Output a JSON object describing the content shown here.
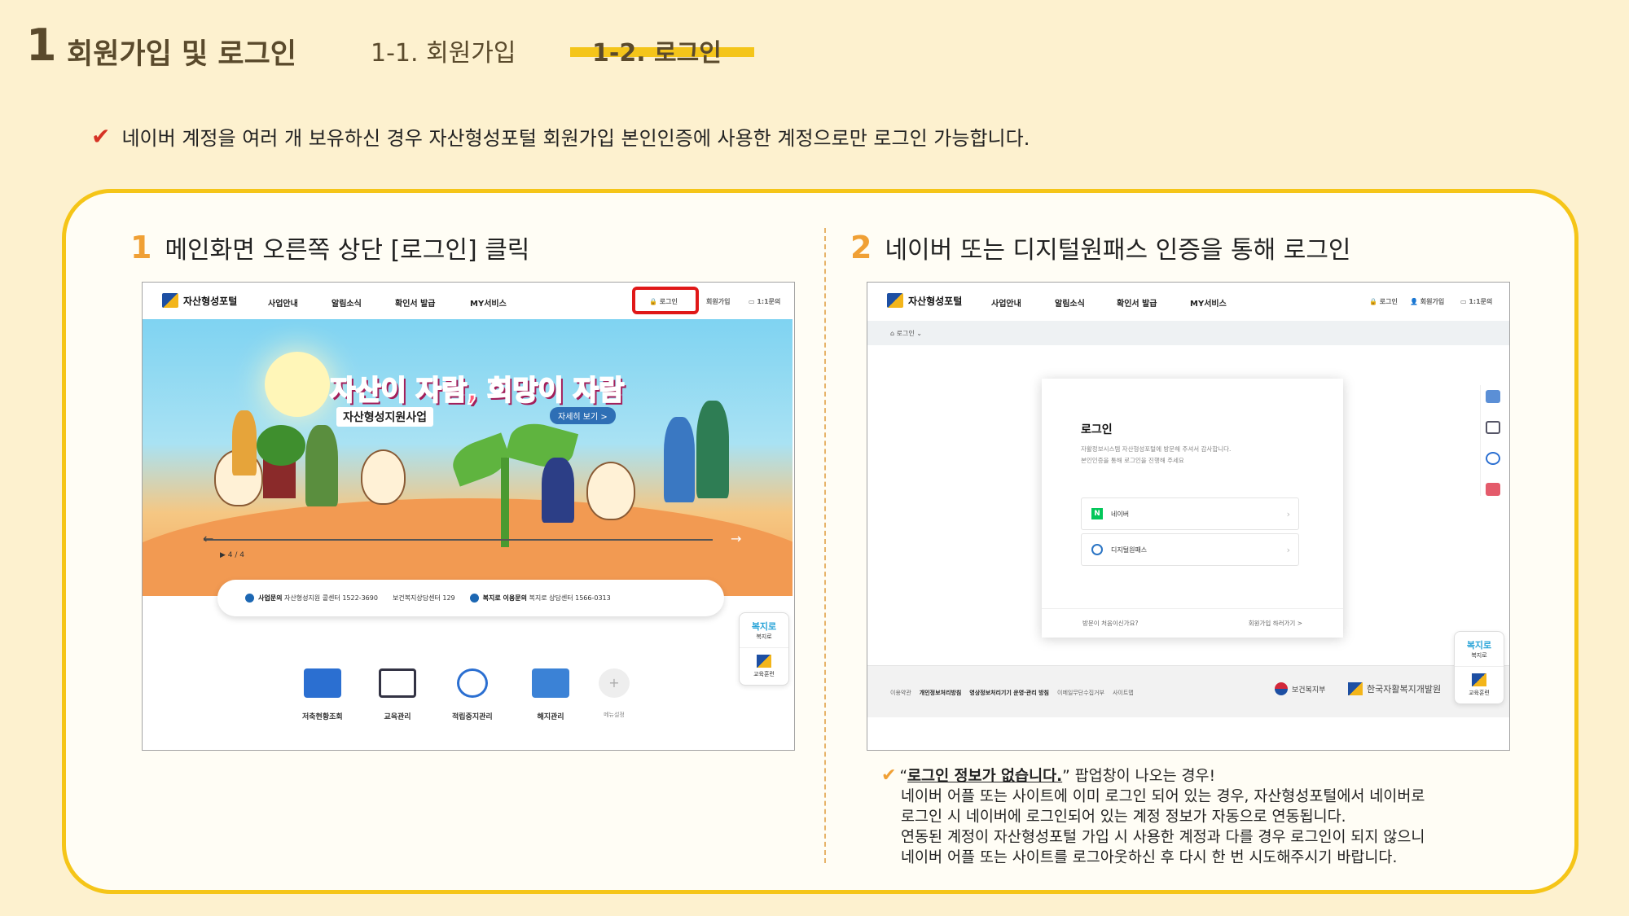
{
  "header": {
    "section_number": "1",
    "section_title": "회원가입 및 로그인",
    "sub_1": "1-1. 회원가입",
    "sub_2": "1-2. 로그인"
  },
  "notice": {
    "check": "✔",
    "text": "네이버 계정을 여러 개 보유하신 경우 자산형성포털 회원가입 본인인증에 사용한 계정으로만 로그인 가능합니다."
  },
  "steps": [
    {
      "num": "1",
      "text": "메인화면 오른쪽 상단 [로그인] 클릭"
    },
    {
      "num": "2",
      "text": "네이버 또는 디지털원패스 인증을 통해 로그인"
    }
  ],
  "site": {
    "logo": "자산형성포털",
    "nav": [
      "사업안내",
      "알림소식",
      "확인서 발급",
      "MY서비스"
    ],
    "util": [
      "로그인",
      "회원가입",
      "1:1문의"
    ]
  },
  "shot1": {
    "banner_title": "자산이 자람, 희망이 자람",
    "banner_subtitle": "자산형성지원사업",
    "banner_more": "자세히 보기 >",
    "pager": "▶  4 / 4",
    "info": [
      {
        "label": "사업문의",
        "text": "자산형성지원 콜센터 1522-3690"
      },
      {
        "label": "",
        "text": "보건복지상담센터 129"
      },
      {
        "label": "복지로 이용문의",
        "text": "복지로 상담센터 1566-0313"
      }
    ],
    "services": [
      "저축현황조회",
      "교육관리",
      "적립중지관리",
      "해지관리",
      "메뉴설정"
    ],
    "side_widget": [
      {
        "logo": "복지로",
        "label": "복지로"
      },
      {
        "label": "교육훈련"
      }
    ]
  },
  "shot2": {
    "breadcrumb": "⌂  로그인  ⌄",
    "card_title": "로그인",
    "card_desc_1": "자활정보시스템 자산형성포털에 방문해 주셔서 감사합니다.",
    "card_desc_2": "본인인증을 통해 로그인을 진행해 주세요",
    "btn_naver": "네이버",
    "btn_digital": "디지털원패스",
    "foot_left": "방문이 처음이신가요?",
    "foot_right": "회원가입 하러가기  >",
    "footer_links": [
      "이용약관",
      "개인정보처리방침",
      "영상정보처리기기 운영·관리 방침",
      "이메일무단수집거부",
      "사이트맵"
    ],
    "footer_org1": "보건복지부",
    "footer_org2": "한국자활복지개발원",
    "side_widget": [
      {
        "logo": "복지로",
        "label": "복지로"
      },
      {
        "label": "교육훈련"
      }
    ]
  },
  "note": {
    "check": "✔",
    "quote_open": "“",
    "highlight": "로그인 정보가 없습니다.",
    "quote_rest": "” 팝업창이 나오는 경우!",
    "lines": [
      "네이버 어플 또는 사이트에 이미 로그인 되어 있는 경우, 자산형성포털에서 네이버로",
      "로그인 시 네이버에 로그인되어 있는 계정 정보가 자동으로 연동됩니다.",
      "연동된 계정이 자산형성포털 가입 시 사용한 계정과 다를 경우 로그인이 되지 않으니",
      "네이버 어플 또는 사이트를 로그아웃하신 후 다시 한 번 시도해주시기 바랍니다."
    ]
  },
  "colors": {
    "background": "#fdf1cf",
    "accent_yellow": "#f5c518",
    "step_orange": "#f0a035",
    "highlight_red": "#e01818"
  }
}
